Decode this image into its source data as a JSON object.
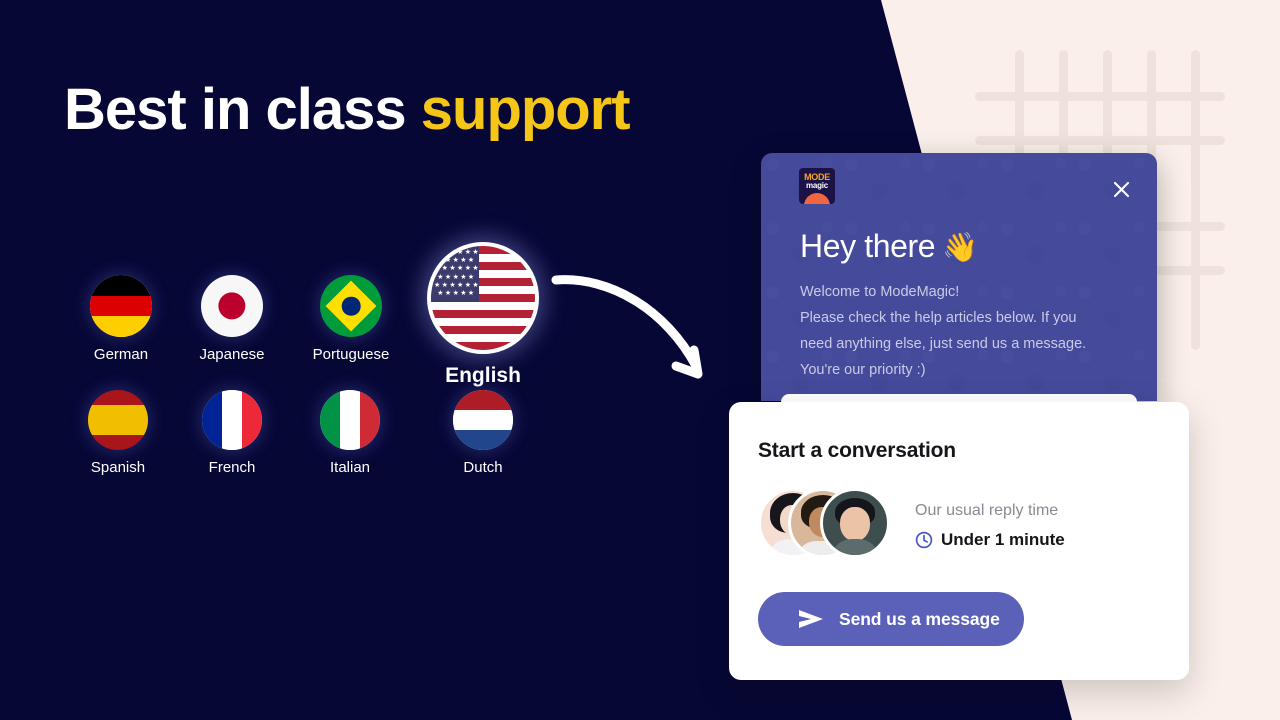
{
  "page": {
    "headline_main": "Best in class",
    "headline_accent": "support",
    "colors": {
      "navy": "#070736",
      "cream": "#FAEFEA",
      "accent_yellow": "#F5C518",
      "indigo_panel": "#454A9B",
      "button_indigo": "#5B61B8",
      "grid_line": "#EFE2DC"
    }
  },
  "languages": [
    {
      "label": "German",
      "code": "de",
      "featured": false
    },
    {
      "label": "Japanese",
      "code": "jp",
      "featured": false
    },
    {
      "label": "Portuguese",
      "code": "br",
      "featured": false
    },
    {
      "label": "English",
      "code": "us",
      "featured": true
    },
    {
      "label": "Spanish",
      "code": "es",
      "featured": false
    },
    {
      "label": "French",
      "code": "fr",
      "featured": false
    },
    {
      "label": "Italian",
      "code": "it",
      "featured": false
    },
    {
      "label": "Dutch",
      "code": "nl",
      "featured": false
    }
  ],
  "arrow": {
    "icon": "curved-arrow-icon"
  },
  "chat_widget": {
    "logo": {
      "top_text": "MODE",
      "bottom_text": "magic",
      "icon": "modemagic-logo-icon"
    },
    "close_icon": "close-icon",
    "greeting": "Hey there",
    "greeting_emoji": "👋",
    "body_line_1": "Welcome to ModeMagic!",
    "body_line_2": "Please check the help articles below. If you need anything else, just send us a message. You're our priority :)"
  },
  "conversation_card": {
    "title": "Start a conversation",
    "reply_label": "Our usual reply time",
    "reply_value": "Under 1 minute",
    "clock_icon": "clock-icon",
    "send_button": {
      "label": "Send us a message",
      "icon": "send-paper-plane-icon"
    },
    "avatars": [
      "avatar-agent-1",
      "avatar-agent-2",
      "avatar-agent-3"
    ]
  }
}
